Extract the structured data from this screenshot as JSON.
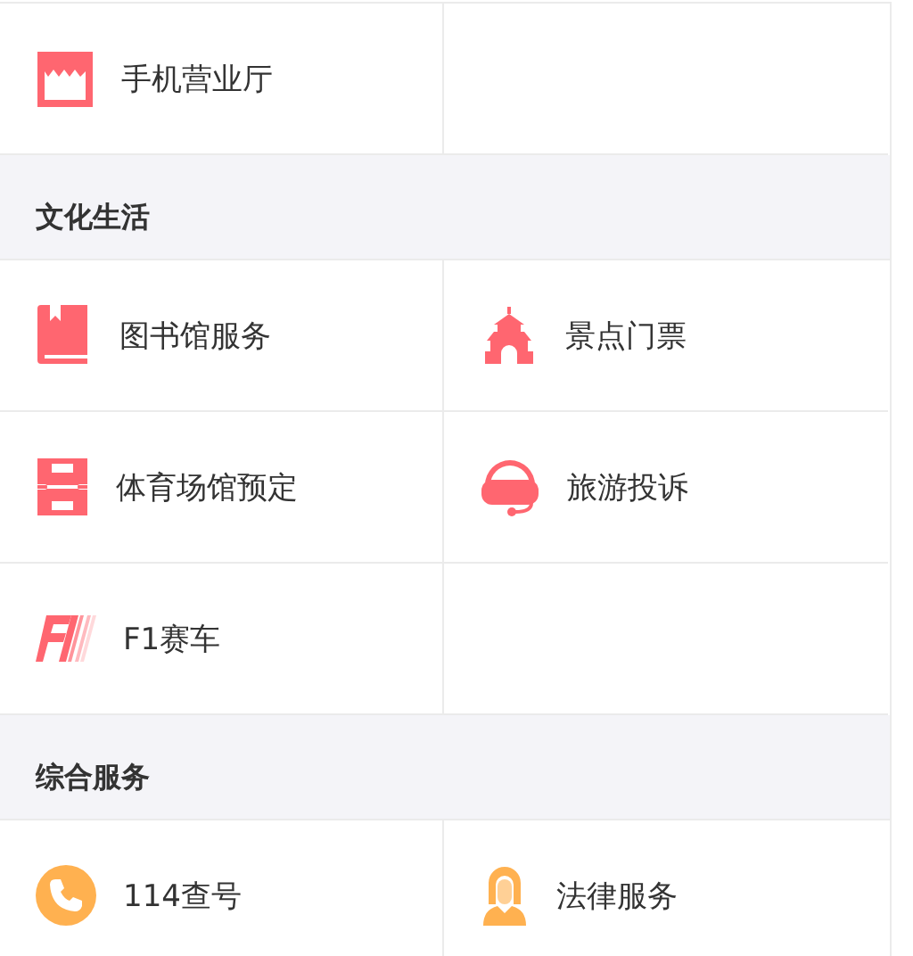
{
  "sections": [
    {
      "items": [
        {
          "label": "手机营业厅",
          "kind": "store"
        }
      ]
    },
    {
      "title": "文化生活",
      "items": [
        {
          "label": "图书馆服务",
          "kind": "book"
        },
        {
          "label": "景点门票",
          "kind": "temple"
        },
        {
          "label": "体育场馆预定",
          "kind": "field"
        },
        {
          "label": "旅游投诉",
          "kind": "headset"
        },
        {
          "label": "F1赛车",
          "kind": "racing"
        }
      ]
    },
    {
      "title": "综合服务",
      "items": [
        {
          "label": "114查号",
          "kind": "phone"
        },
        {
          "label": "法律服务",
          "kind": "judge"
        }
      ]
    }
  ]
}
